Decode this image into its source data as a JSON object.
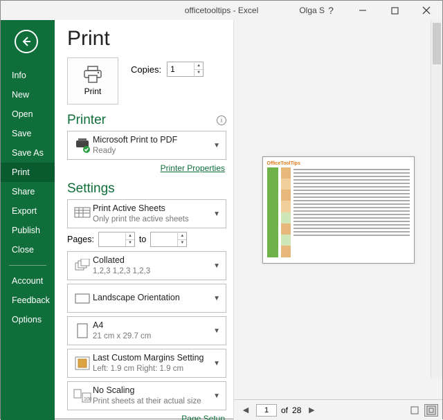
{
  "window": {
    "title": "officetooltips - Excel",
    "user": "Olga S"
  },
  "sidebar": {
    "items": [
      {
        "label": "Info"
      },
      {
        "label": "New"
      },
      {
        "label": "Open"
      },
      {
        "label": "Save"
      },
      {
        "label": "Save As"
      },
      {
        "label": "Print"
      },
      {
        "label": "Share"
      },
      {
        "label": "Export"
      },
      {
        "label": "Publish"
      },
      {
        "label": "Close"
      }
    ],
    "footer": [
      {
        "label": "Account"
      },
      {
        "label": "Feedback"
      },
      {
        "label": "Options"
      }
    ]
  },
  "page": {
    "title": "Print"
  },
  "print_button": {
    "label": "Print"
  },
  "copies": {
    "label": "Copies:",
    "value": "1"
  },
  "printer": {
    "heading": "Printer",
    "name": "Microsoft Print to PDF",
    "status": "Ready",
    "properties_link": "Printer Properties"
  },
  "settings": {
    "heading": "Settings",
    "sheets": {
      "main": "Print Active Sheets",
      "sub": "Only print the active sheets"
    },
    "pages": {
      "label": "Pages:",
      "to": "to"
    },
    "collate": {
      "main": "Collated",
      "sub": "1,2,3    1,2,3    1,2,3"
    },
    "orientation": {
      "main": "Landscape Orientation"
    },
    "paper": {
      "main": "A4",
      "sub": "21 cm x 29.7 cm"
    },
    "margins": {
      "main": "Last Custom Margins Setting",
      "sub": "Left:  1.9 cm     Right:  1.9 cm"
    },
    "scaling": {
      "main": "No Scaling",
      "sub": "Print sheets at their actual size"
    },
    "pagesetup_link": "Page Setup"
  },
  "preview": {
    "doc_title": "OfficeToolTips",
    "current_page": "1",
    "page_sep": "of",
    "total_pages": "28"
  }
}
